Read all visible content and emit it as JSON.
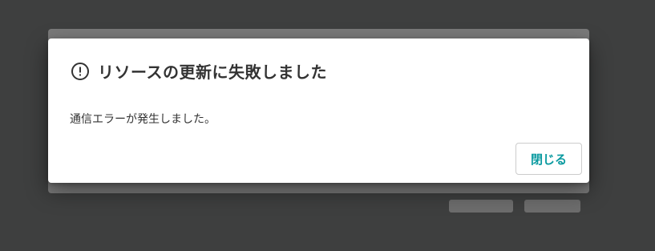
{
  "dialog": {
    "icon": "alert-circle-icon",
    "title": "リソースの更新に失敗しました",
    "message": "通信エラーが発生しました。",
    "close_label": "閉じる"
  },
  "colors": {
    "backdrop": "#3e3f3f",
    "dialog_background": "#ffffff",
    "title_text": "#333333",
    "accent": "#0a9aa0",
    "button_border": "#cccccc"
  }
}
